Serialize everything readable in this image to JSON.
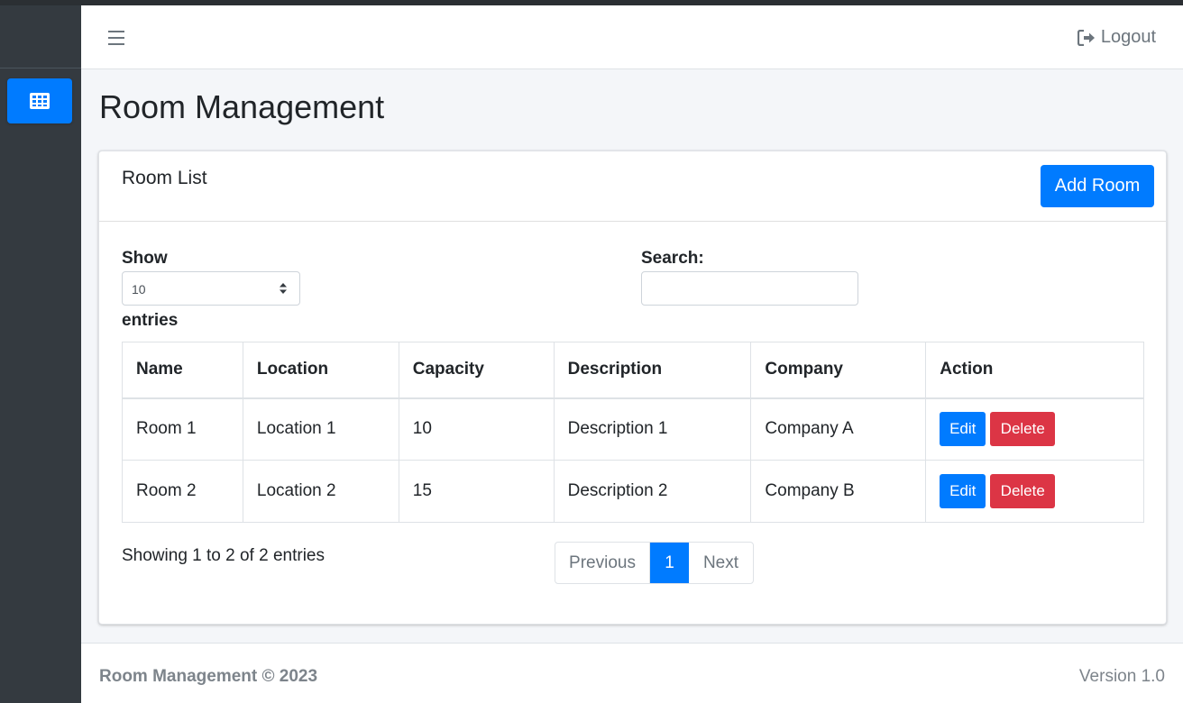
{
  "navbar": {
    "logout_label": "Logout"
  },
  "page": {
    "title": "Room Management"
  },
  "card": {
    "title": "Room List",
    "add_button_label": "Add Room"
  },
  "controls": {
    "show_label": "Show",
    "entries_label": "entries",
    "page_length_value": "10",
    "search_label": "Search:",
    "search_value": ""
  },
  "table": {
    "headers": [
      "Name",
      "Location",
      "Capacity",
      "Description",
      "Company",
      "Action"
    ],
    "rows": [
      {
        "name": "Room 1",
        "location": "Location 1",
        "capacity": "10",
        "description": "Description 1",
        "company": "Company A"
      },
      {
        "name": "Room 2",
        "location": "Location 2",
        "capacity": "15",
        "description": "Description 2",
        "company": "Company B"
      }
    ],
    "edit_label": "Edit",
    "delete_label": "Delete"
  },
  "pagination": {
    "info": "Showing 1 to 2 of 2 entries",
    "previous_label": "Previous",
    "current_page": "1",
    "next_label": "Next"
  },
  "footer": {
    "copyright": "Room Management © 2023",
    "version": "Version 1.0"
  },
  "colors": {
    "primary": "#007bff",
    "danger": "#dc3545",
    "sidebar": "#343a40"
  },
  "icons": {
    "sidebar_item": "table-grid-icon",
    "menu_toggle": "hamburger-icon",
    "logout": "sign-out-icon"
  }
}
